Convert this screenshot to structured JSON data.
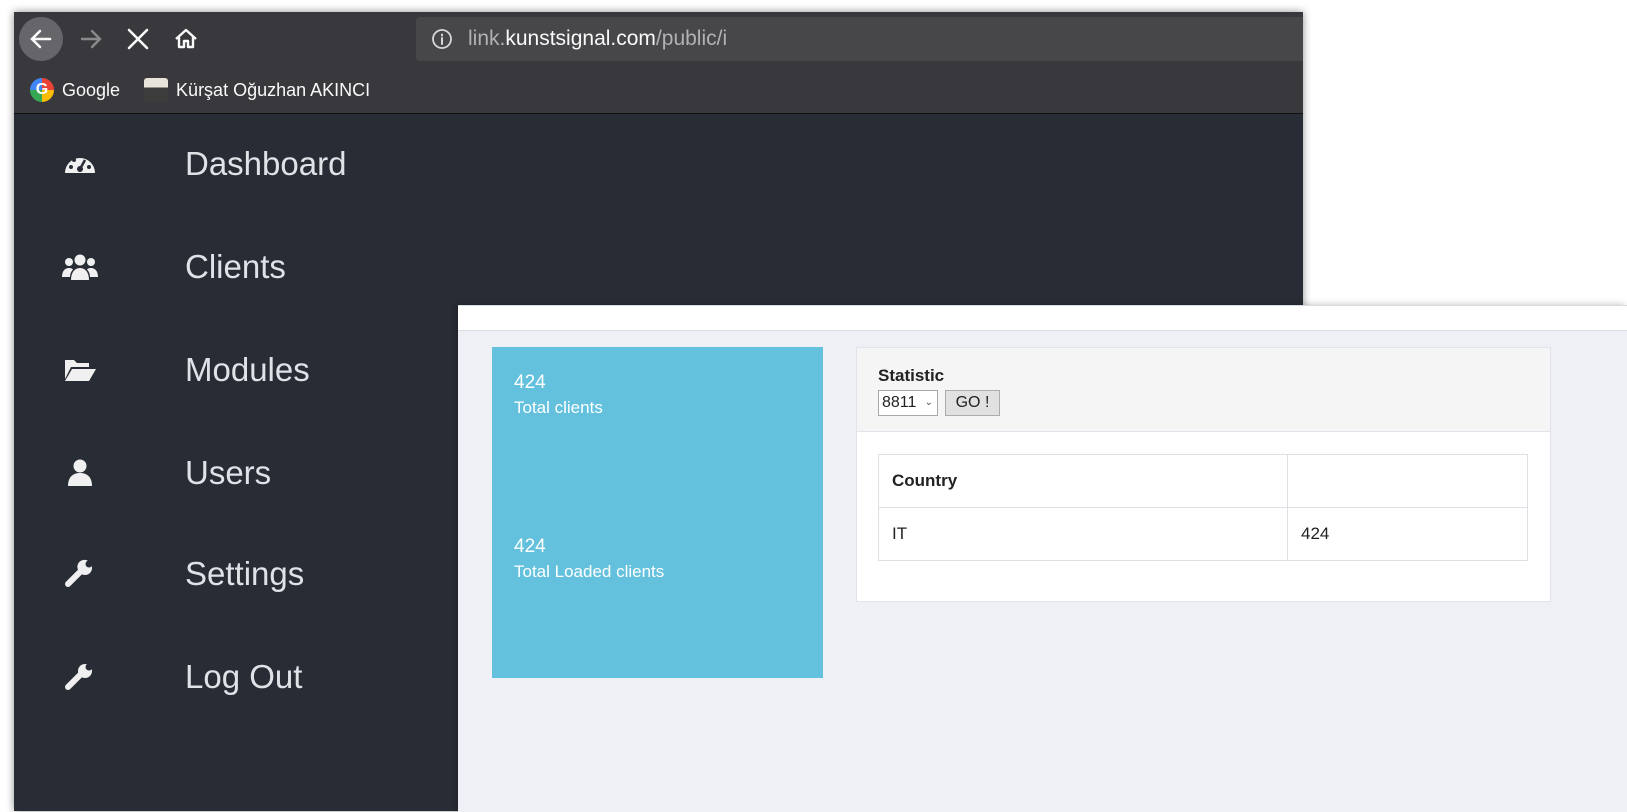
{
  "browser": {
    "url_prefix": "link.",
    "url_domain": "kunstsignal.com",
    "url_path": "/public/i",
    "bookmarks": [
      {
        "label": "Google",
        "icon": "google-icon"
      },
      {
        "label": "Kürşat Oğuzhan AKINCI",
        "icon": "user-avatar-icon"
      }
    ]
  },
  "sidebar": {
    "items": [
      {
        "label": "Dashboard",
        "icon": "dashboard-icon"
      },
      {
        "label": "Clients",
        "icon": "users-icon"
      },
      {
        "label": "Modules",
        "icon": "folder-open-icon"
      },
      {
        "label": "Users",
        "icon": "user-icon"
      },
      {
        "label": "Settings",
        "icon": "wrench-icon"
      },
      {
        "label": "Log Out",
        "icon": "wrench-icon"
      }
    ]
  },
  "stats": {
    "total_clients": "424",
    "total_clients_label": "Total clients",
    "total_loaded": "424",
    "total_loaded_label": "Total Loaded clients",
    "tile_color": "#63c1dd"
  },
  "statistic": {
    "title": "Statistic",
    "selected": "8811",
    "go_label": "GO !",
    "table": {
      "headers": [
        "Country",
        ""
      ],
      "rows": [
        [
          "IT",
          "424"
        ]
      ]
    }
  }
}
